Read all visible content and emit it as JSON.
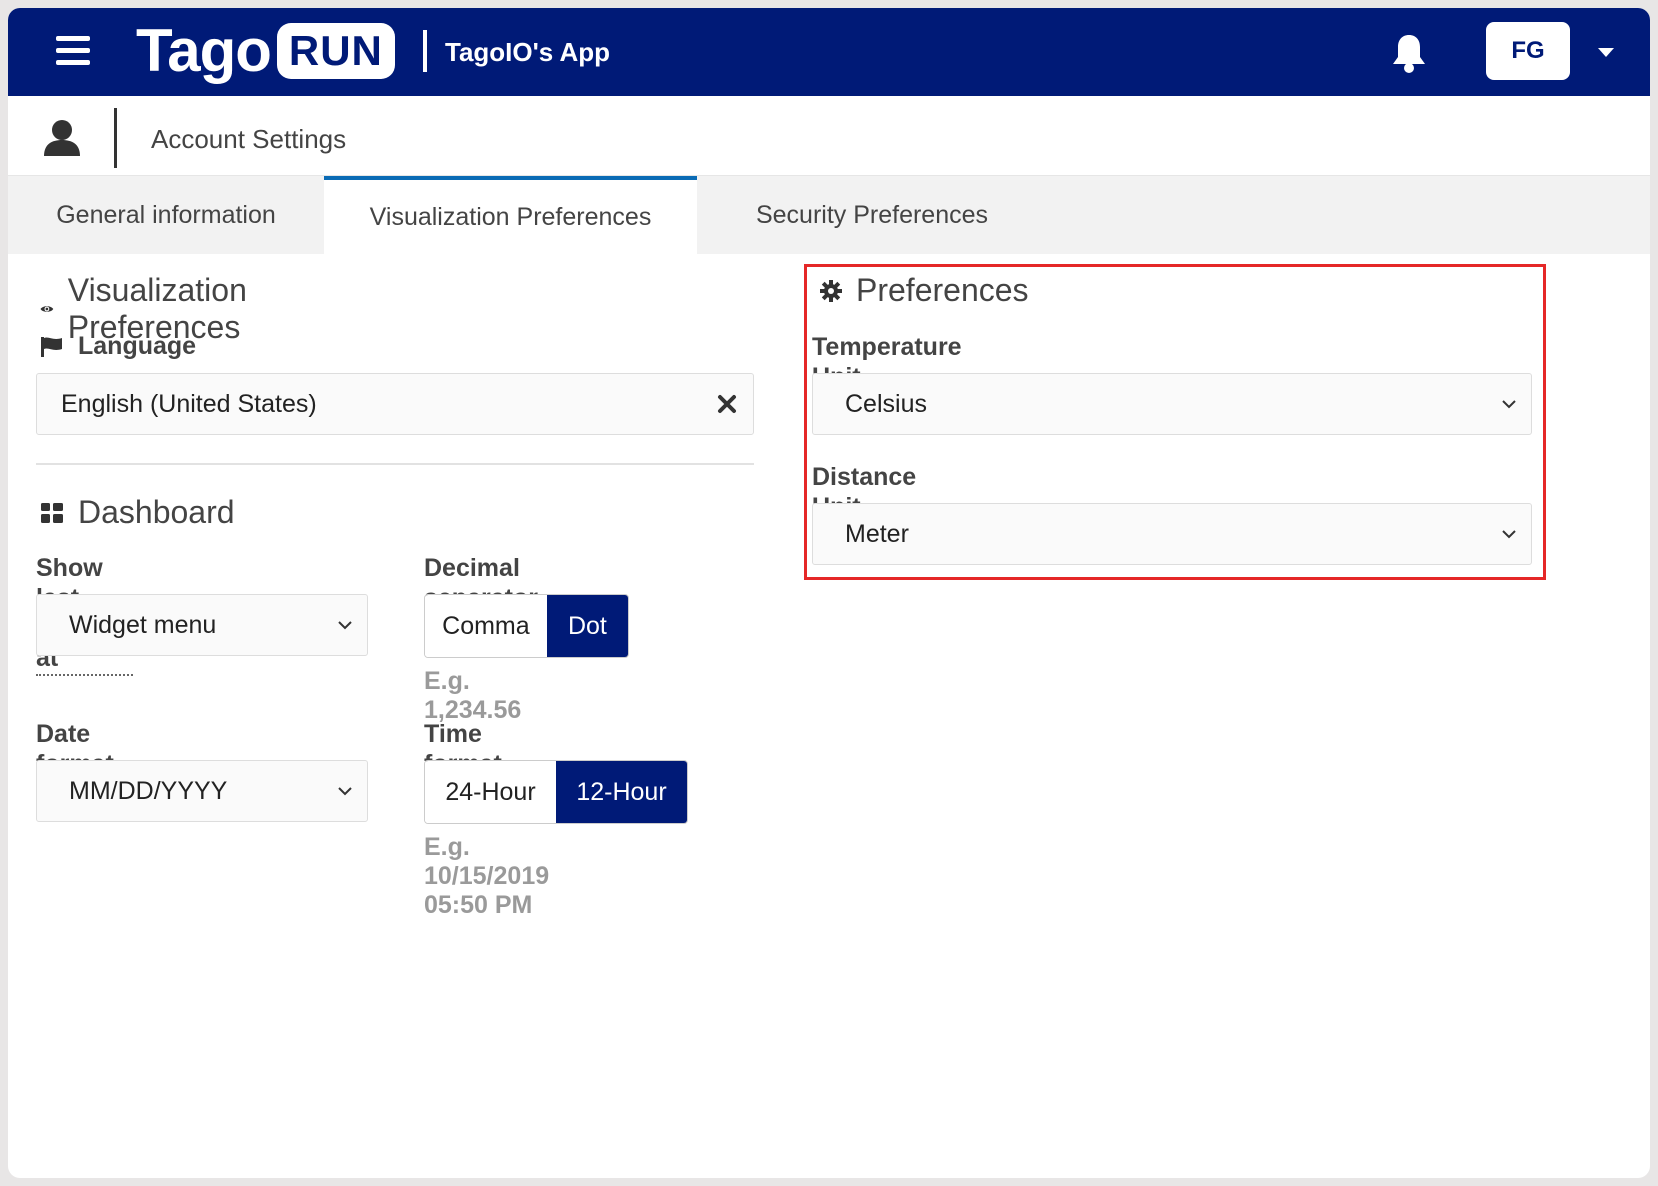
{
  "header": {
    "logo_text": "Tago",
    "logo_badge": "RUN",
    "app_name": "TagoIO's App",
    "user_initials": "FG"
  },
  "subheader": {
    "title": "Account Settings"
  },
  "tabs": [
    {
      "label": "General information",
      "active": false
    },
    {
      "label": "Visualization Preferences",
      "active": true
    },
    {
      "label": "Security Preferences",
      "active": false
    }
  ],
  "visualization": {
    "title": "Visualization Preferences",
    "language_label": "Language",
    "language_value": "English (United States)"
  },
  "dashboard": {
    "title": "Dashboard",
    "show_last_updated_label": "Show last updated at",
    "show_last_updated_value": "Widget menu",
    "decimal_separator_label": "Decimal separator",
    "decimal_options": [
      "Comma",
      "Dot"
    ],
    "decimal_selected": "Dot",
    "decimal_example": "E.g. 1,234.56",
    "date_format_label": "Date format",
    "date_format_value": "MM/DD/YYYY",
    "time_format_label": "Time format",
    "time_options": [
      "24-Hour",
      "12-Hour"
    ],
    "time_selected": "12-Hour",
    "time_example": "E.g. 10/15/2019 05:50 PM"
  },
  "preferences": {
    "title": "Preferences",
    "temperature_label": "Temperature Unit",
    "temperature_value": "Celsius",
    "distance_label": "Distance Unit",
    "distance_value": "Meter"
  },
  "colors": {
    "brand": "#001a77",
    "tab_accent": "#0a6bb5",
    "highlight": "#e52828"
  }
}
